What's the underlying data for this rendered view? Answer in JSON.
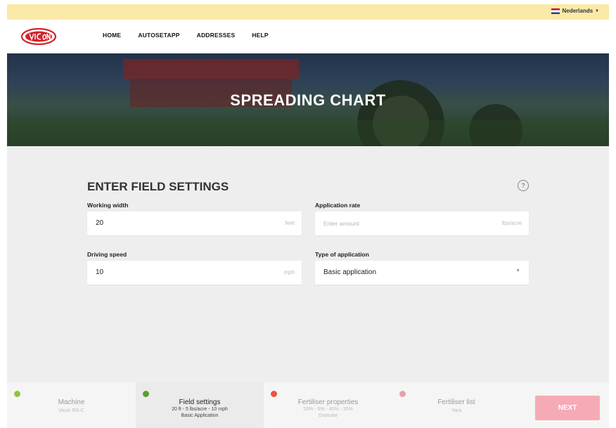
{
  "language": {
    "label": "Nederlands"
  },
  "nav": {
    "items": [
      "HOME",
      "AUTOSETAPP",
      "ADDRESSES",
      "HELP"
    ]
  },
  "hero": {
    "title": "SPREADING CHART"
  },
  "form": {
    "title": "ENTER FIELD SETTINGS",
    "help_glyph": "?",
    "working_width": {
      "label": "Working width",
      "value": "20",
      "unit": "feet"
    },
    "application_rate": {
      "label": "Application rate",
      "placeholder": "Enter amount",
      "unit": "lbs/acre"
    },
    "driving_speed": {
      "label": "Driving speed",
      "value": "10",
      "unit": "mph"
    },
    "type_of_application": {
      "label": "Type of application",
      "value": "Basic application"
    }
  },
  "steps": [
    {
      "title": "Machine",
      "sub": [
        "Vicon RS-C"
      ],
      "status_color": "#8cc63f"
    },
    {
      "title": "Field settings",
      "sub": [
        "20 ft - 5 lbs/acre - 10 mph",
        "Basic Application"
      ],
      "status_color": "#5a9e2f"
    },
    {
      "title": "Fertiliser properties",
      "sub": [
        "33% - 5% - 40% - 35%",
        "Granular"
      ],
      "status_color": "#e8553f"
    },
    {
      "title": "Fertiliser list",
      "sub": [
        "Yara"
      ],
      "status_color": "#e8a0a8"
    }
  ],
  "next_button": {
    "label": "NEXT",
    "color": "#f6aab6"
  },
  "colors": {
    "brand_red": "#d2232a",
    "topbar": "#fbe9a8"
  }
}
